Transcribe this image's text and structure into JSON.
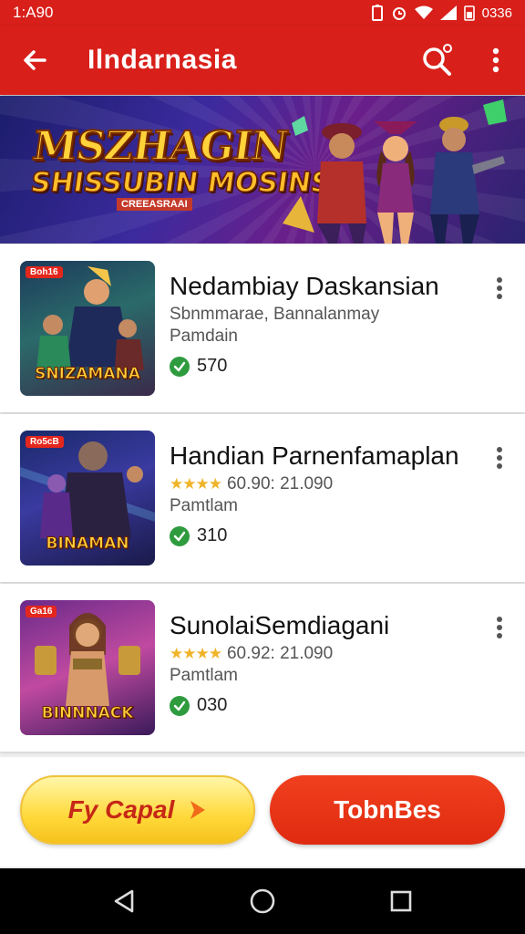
{
  "status_bar": {
    "time": "1:A90",
    "clock_right": "0336"
  },
  "app_bar": {
    "title": "Ilndarnasia"
  },
  "banner": {
    "line1": "MSZHAGIN",
    "line2": "SHISSUBIN MOSINS",
    "tag": "CREEASRAAI"
  },
  "games": [
    {
      "name": "Nedambiay Daskansian",
      "meta": "Sbnmmarae, Bannalanmay",
      "category": "Pamdain",
      "count": "570",
      "tag": "Boh16",
      "thumb_label": "SNIZAMANA",
      "has_rating": false
    },
    {
      "name": "Handian Parnenfamaplan",
      "meta": "60.90: 21.090",
      "category": "Pamtlam",
      "count": "310",
      "tag": "Ro5cB",
      "thumb_label": "BINAMAN",
      "has_rating": true
    },
    {
      "name": "SunolaiSemdiagani",
      "meta": "60.92: 21.090",
      "category": "Pamtlam",
      "count": "030",
      "tag": "Ga16",
      "thumb_label": "BINNNACK",
      "has_rating": true
    }
  ],
  "buttons": {
    "primary": "Fy Capal",
    "secondary": "TobnBes"
  },
  "icons": [
    "back-arrow-icon",
    "search-icon",
    "more-vert-icon",
    "check-icon",
    "nav-back-icon",
    "nav-home-icon",
    "nav-recents-icon"
  ],
  "colors": {
    "brand_red": "#d91f1a",
    "check_green": "#2e9b3f",
    "star_yellow": "#f0b429",
    "button_yellow": "#ffd93a"
  }
}
